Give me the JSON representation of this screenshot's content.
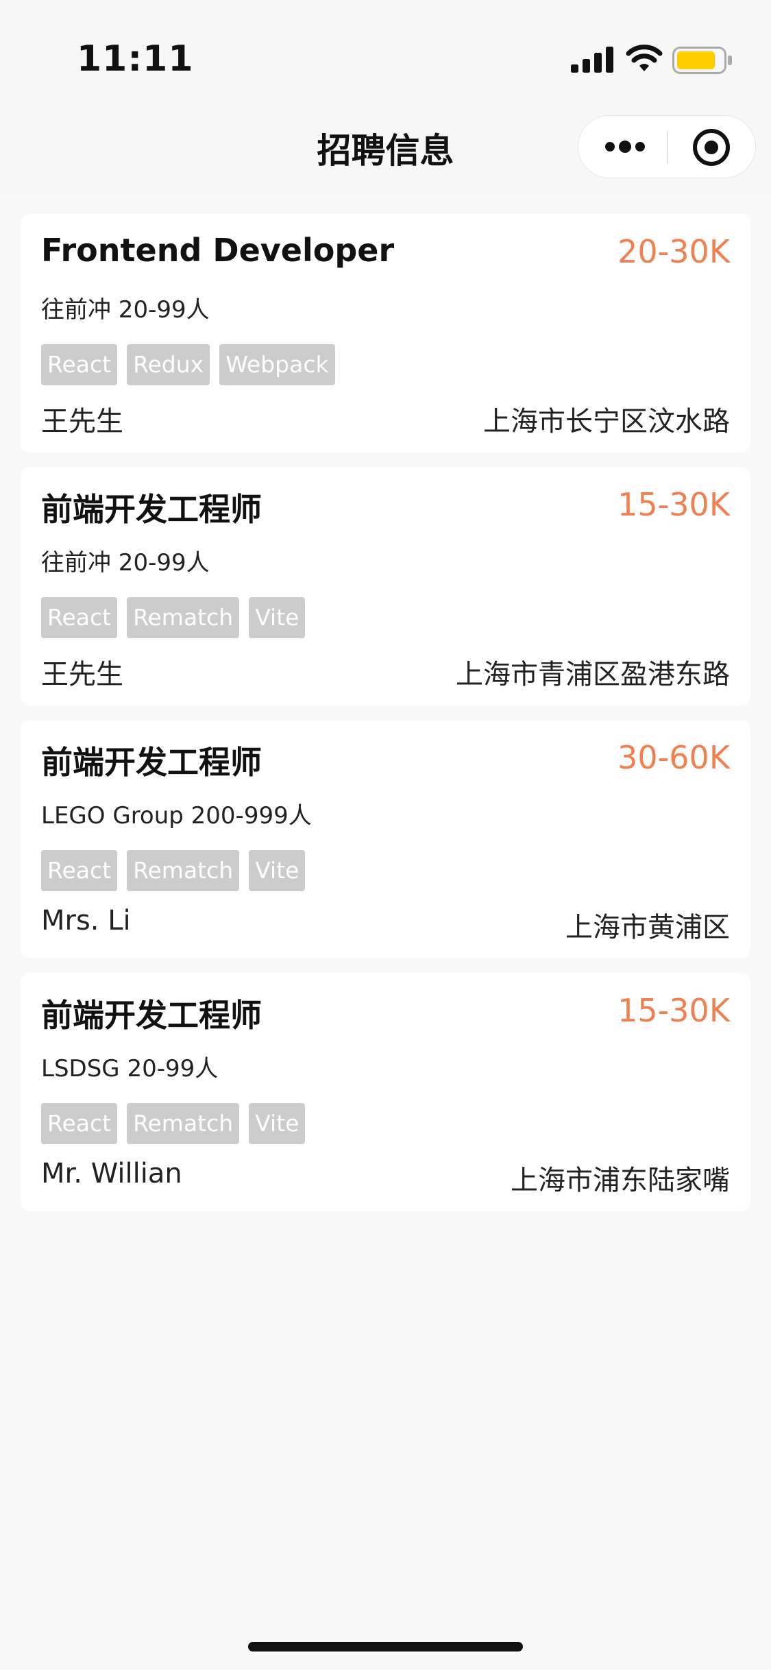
{
  "status_bar": {
    "time": "11:11",
    "icons": [
      "signal-icon",
      "wifi-icon",
      "battery-icon"
    ],
    "battery_color": "#FFCC00"
  },
  "nav": {
    "title": "招聘信息",
    "capsule_icons": [
      "more-icon",
      "target-icon"
    ]
  },
  "colors": {
    "salary": "#F08050",
    "tag_bg": "#CCCCCC"
  },
  "jobs": [
    {
      "title": "Frontend Developer",
      "salary": "20-30K",
      "company": "往前冲 20-99人",
      "tags": [
        "React",
        "Redux",
        "Webpack"
      ],
      "contact": "王先生",
      "address": "上海市长宁区汶水路"
    },
    {
      "title": "前端开发工程师",
      "salary": "15-30K",
      "company": "往前冲 20-99人",
      "tags": [
        "React",
        "Rematch",
        "Vite"
      ],
      "contact": "王先生",
      "address": "上海市青浦区盈港东路"
    },
    {
      "title": "前端开发工程师",
      "salary": "30-60K",
      "company": "LEGO Group 200-999人",
      "tags": [
        "React",
        "Rematch",
        "Vite"
      ],
      "contact": "Mrs. Li",
      "address": "上海市黄浦区"
    },
    {
      "title": "前端开发工程师",
      "salary": "15-30K",
      "company": "LSDSG 20-99人",
      "tags": [
        "React",
        "Rematch",
        "Vite"
      ],
      "contact": "Mr. Willian",
      "address": "上海市浦东陆家嘴"
    }
  ]
}
